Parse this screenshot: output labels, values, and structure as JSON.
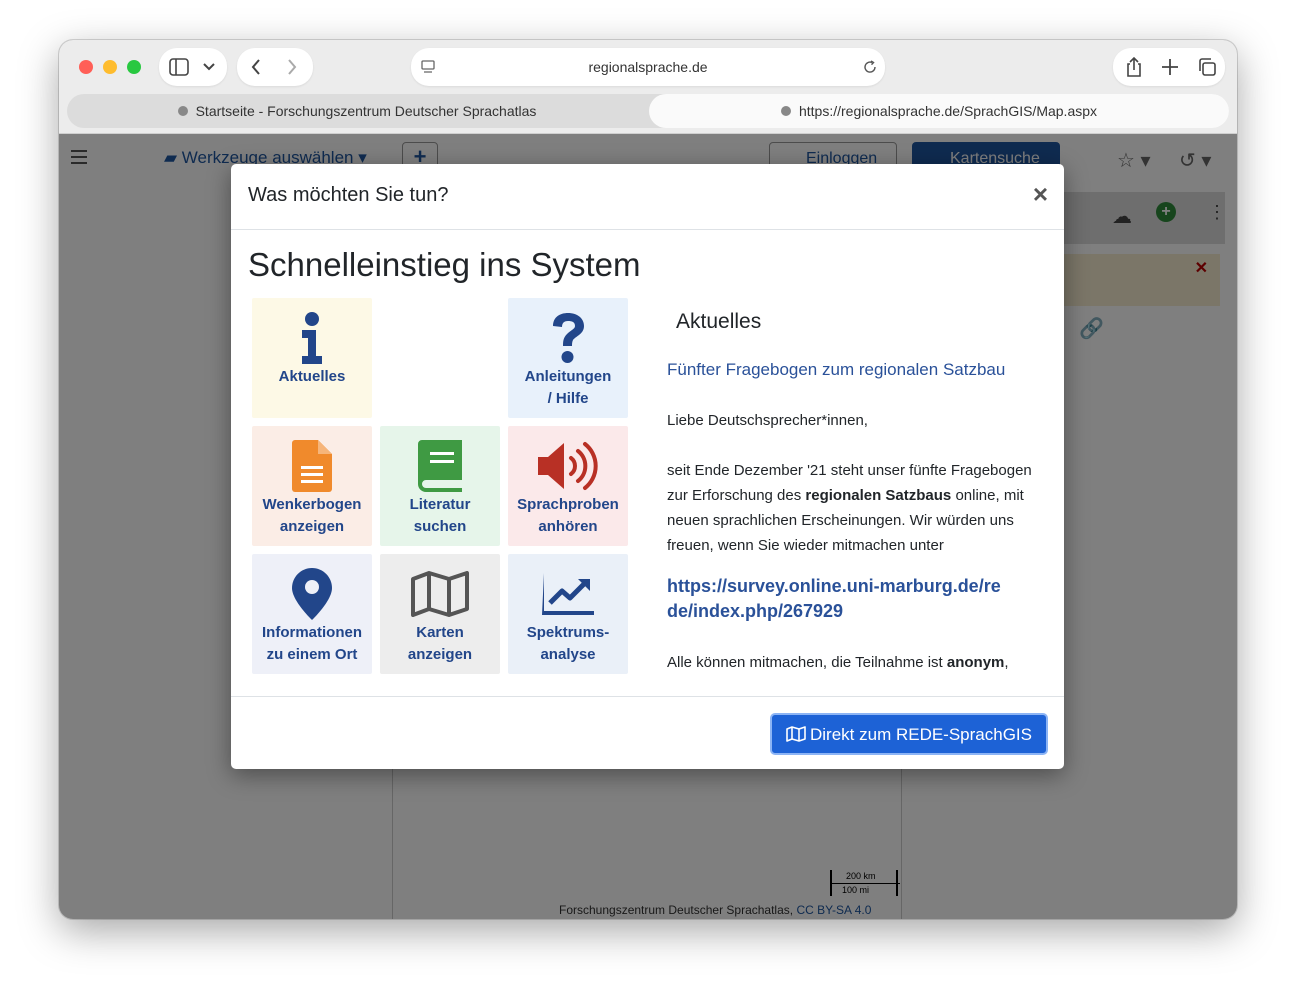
{
  "browser": {
    "address": "regionalsprache.de",
    "tabs": [
      {
        "label": "Startseite - Forschungszentrum Deutscher Sprachatlas"
      },
      {
        "label": "https://regionalsprache.de/SprachGIS/Map.aspx"
      }
    ]
  },
  "app": {
    "tools_label": "Werkzeuge auswählen",
    "add_label": "+",
    "login_label": "Einloggen",
    "map_search_label": "Kartensuche",
    "scale_km": "200 km",
    "scale_mi": "100 mi",
    "attribution": "Forschungszentrum Deutscher Sprachatlas,",
    "license": "CC BY-SA 4.0"
  },
  "modal": {
    "title": "Was möchten Sie tun?",
    "close_label": "×",
    "heading": "Schnelleinstieg ins System",
    "tiles": [
      {
        "label": "Aktuelles",
        "icon": "info-icon",
        "bg": "#fdf9e6",
        "color": "#22468a"
      },
      {
        "label": "Anleitungen\n/ Hilfe",
        "icon": "question-icon",
        "bg": "#e8f1fb",
        "color": "#22468a"
      },
      {
        "label": "Wenkerbogen\nanzeigen",
        "icon": "document-icon",
        "bg": "#fbede6",
        "color": "#f08a2c"
      },
      {
        "label": "Literatur\nsuchen",
        "icon": "book-icon",
        "bg": "#e6f5ea",
        "color": "#3f9a43"
      },
      {
        "label": "Sprachproben\nanhören",
        "icon": "speaker-icon",
        "bg": "#fbe9ea",
        "color": "#b83025"
      },
      {
        "label": "Informationen\nzu einem Ort",
        "icon": "map-marker-icon",
        "bg": "#eef0f8",
        "color": "#22468a"
      },
      {
        "label": "Karten\nanzeigen",
        "icon": "map-icon",
        "bg": "#ededed",
        "color": "#555555"
      },
      {
        "label": "Spektrums-\nanalyse",
        "icon": "chart-icon",
        "bg": "#eaf0f8",
        "color": "#22468a"
      }
    ],
    "news": {
      "heading": "Aktuelles",
      "link": "Fünfter Fragebogen zum regionalen Satzbau",
      "greeting": "Liebe Deutschsprecher*innen,",
      "p1_a": "seit Ende Dezember '21 steht unser fünfte Fragebogen zur Erforschung des ",
      "p1_bold": "regionalen Satzbaus",
      "p1_b": " online, mit neuen sprachlichen Erscheinungen. Wir würden uns freuen, wenn Sie wieder mitmachen unter",
      "url": "https://survey.online.uni-marburg.de/rede/index.php/267929",
      "p2_a": "Alle können mitmachen, die Teilnahme ist ",
      "p2_bold": "anonym",
      "p2_b": ","
    },
    "go_button": "Direkt zum REDE-SprachGIS"
  }
}
